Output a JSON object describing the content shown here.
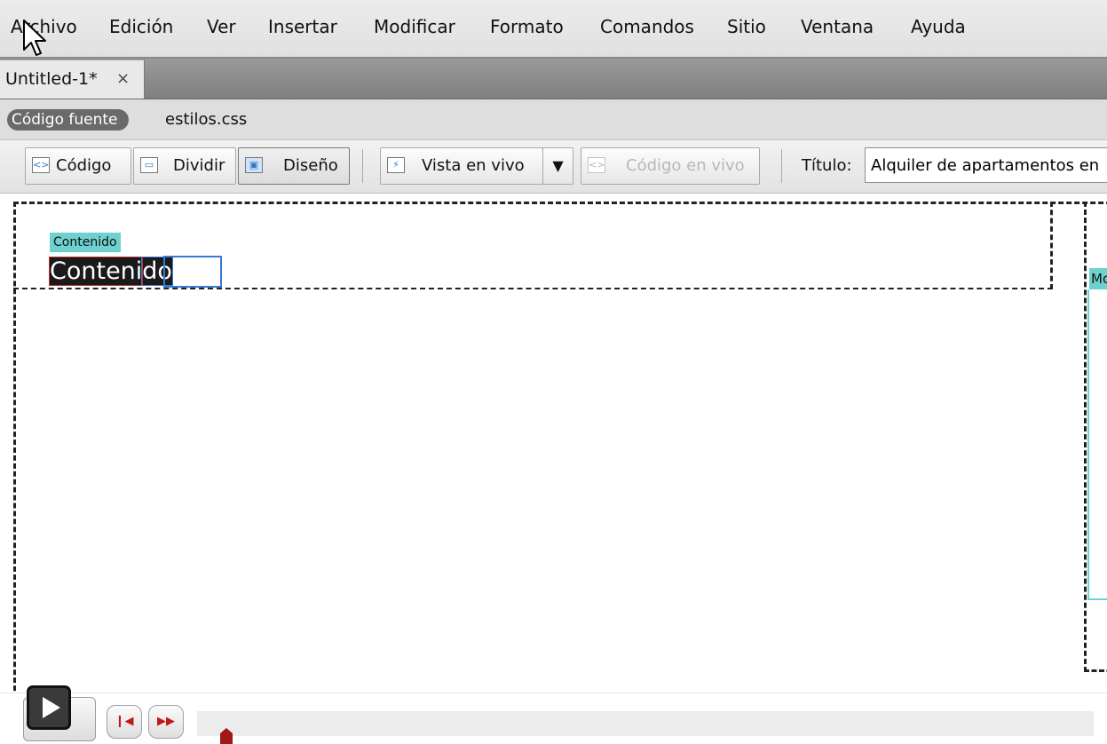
{
  "menu": {
    "items": [
      "Archivo",
      "Edición",
      "Ver",
      "Insertar",
      "Modificar",
      "Formato",
      "Comandos",
      "Sitio",
      "Ventana",
      "Ayuda"
    ]
  },
  "tabs": {
    "doc_title": "Untitled-1*",
    "close_glyph": "×"
  },
  "related": {
    "source_label": "Código fuente",
    "file": "estilos.css"
  },
  "toolbar": {
    "code_label": "Código",
    "split_label": "Dividir",
    "design_label": "Diseño",
    "live_view_label": "Vista en vivo",
    "live_code_label": "Código en vivo",
    "title_label": "Título:",
    "title_value": "Alquiler de apartamentos en"
  },
  "design": {
    "region_tag": "Contenido",
    "text_selected": "Conteni",
    "text_rest": "do",
    "side_tag": "Mo"
  },
  "colors": {
    "region_accent": "#6fd0d0",
    "selection_outline": "#3a78d8",
    "playback_accent": "#c01818"
  }
}
